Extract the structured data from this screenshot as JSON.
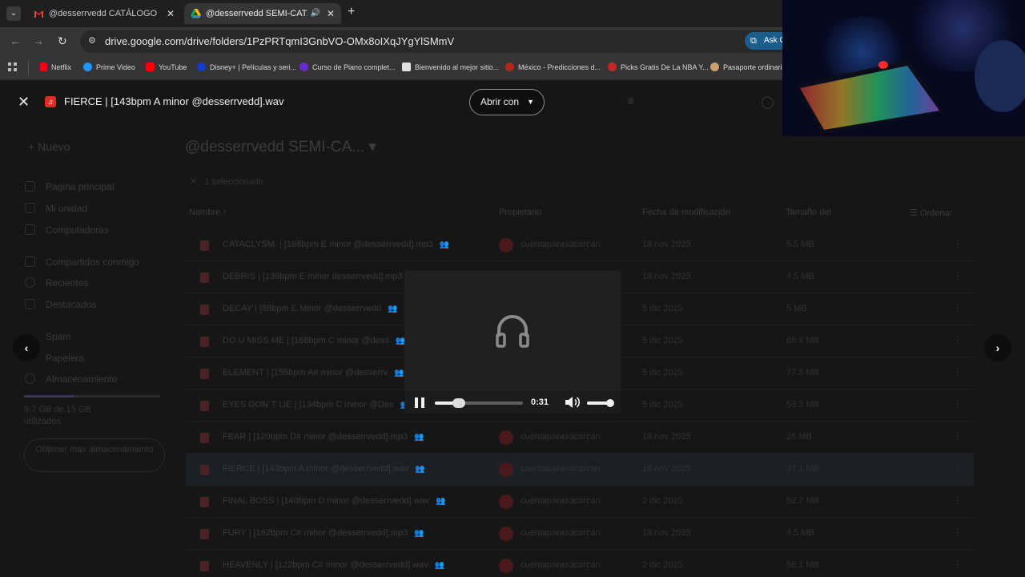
{
  "browser": {
    "tabs": [
      {
        "title": "@desserrvedd CATÁLOGO - pillsinthe",
        "active": false
      },
      {
        "title": "@desserrvedd SEMI-CATÁLOGO",
        "active": true
      }
    ],
    "url": "drive.google.com/drive/folders/1PzPRTqmI3GnbVO-OMx8oIXqJYgYlSMmV",
    "ask_label": "Ask G",
    "bookmarks": [
      {
        "label": "Netflix",
        "color": "#e50914"
      },
      {
        "label": "Prime Video",
        "color": "#1a98ff"
      },
      {
        "label": "YouTube",
        "color": "#ff0000"
      },
      {
        "label": "Disney+ | Películas y seri...",
        "color": "#113ccf"
      },
      {
        "label": "Curso de Piano complet...",
        "color": "#6a2bd1"
      },
      {
        "label": "Bienvenido al mejor sitio...",
        "color": "#e0e0e0"
      },
      {
        "label": "México - Predicciones d...",
        "color": "#b3261e"
      },
      {
        "label": "Picks Gratis De La NBA Y...",
        "color": "#c62828"
      },
      {
        "label": "Pasaporte ordinario",
        "color": "#c9a06c"
      }
    ]
  },
  "viewer": {
    "file_title": "FIERCE | [143bpm A minor @desserrvedd].wav",
    "open_with_label": "Abrir con",
    "player": {
      "time": "0:31",
      "progress": 0.27,
      "volume": 0.9,
      "state": "playing"
    }
  },
  "drive": {
    "new_label": "Nuevo",
    "sidebar": [
      "Página principal",
      "Mi unidad",
      "Computadoras",
      "Compartidos conmigo",
      "Recientes",
      "Destacados",
      "Spam",
      "Papelera",
      "Almacenamiento"
    ],
    "storage_text": "9,7 GB de 15 GB utilizados",
    "storage_fraction": 0.65,
    "get_more_label": "Obtener más almacenamiento",
    "folder_title": "@desserrvedd SEMI-CA...",
    "selected_label": "1 seleccionado",
    "columns": {
      "name": "Nombre",
      "owner": "Propietario",
      "modified": "Fecha de modificación",
      "size": "Tamaño del",
      "sort": "Ordenar"
    },
    "files": [
      {
        "name": "CATACLYSM. | [168bpm E minor @desserrvedd].mp3",
        "owner": "cuentaparasacarcan",
        "date": "18 nov 2025",
        "size": "5.5 MB"
      },
      {
        "name": "DEBRIS | [136bpm E minor desserrvedd].mp3",
        "owner": "",
        "date": "18 nov 2025",
        "size": "4.5 MB"
      },
      {
        "name": "DECAY | [88bpm E Minor @desserrvedd",
        "owner": "",
        "date": "5 dic 2025",
        "size": "5 MB"
      },
      {
        "name": "DO U MISS ME | [168bpm C minor @dess",
        "owner": "",
        "date": "5 dic 2025",
        "size": "69.9 MB"
      },
      {
        "name": "ELEMENT | [155bpm A# minor @desserrv",
        "owner": "",
        "date": "5 dic 2025",
        "size": "77.5 MB"
      },
      {
        "name": "EYES DON´T LIE | [134bpm C minor @Des",
        "owner": "",
        "date": "5 dic 2025",
        "size": "53.3 MB"
      },
      {
        "name": "FEAR | [120bpm D# minor @desserrvedd].mp3",
        "owner": "cuentaparasacarcan",
        "date": "18 nov 2025",
        "size": "25 MB"
      },
      {
        "name": "FIERCE | [143bpm A minor @desserrvedd].wav",
        "owner": "cuentaparasacarcan",
        "date": "18 nov 2025",
        "size": "37.1 MB"
      },
      {
        "name": "FINAL BOSS | [140bpm D minor @desserrvedd].wav",
        "owner": "cuentaparasacarcan",
        "date": "2 dic 2025",
        "size": "52.7 MB"
      },
      {
        "name": "FURY | [162bpm C# minor @desserrvedd].mp3",
        "owner": "cuentaparasacarcan",
        "date": "18 nov 2025",
        "size": "4.5 MB"
      },
      {
        "name": "HEAVENLY | [122bpm C# minor @desserrvedd].wav",
        "owner": "cuentaparasacarcan",
        "date": "2 dic 2025",
        "size": "56.1 MB"
      }
    ]
  }
}
